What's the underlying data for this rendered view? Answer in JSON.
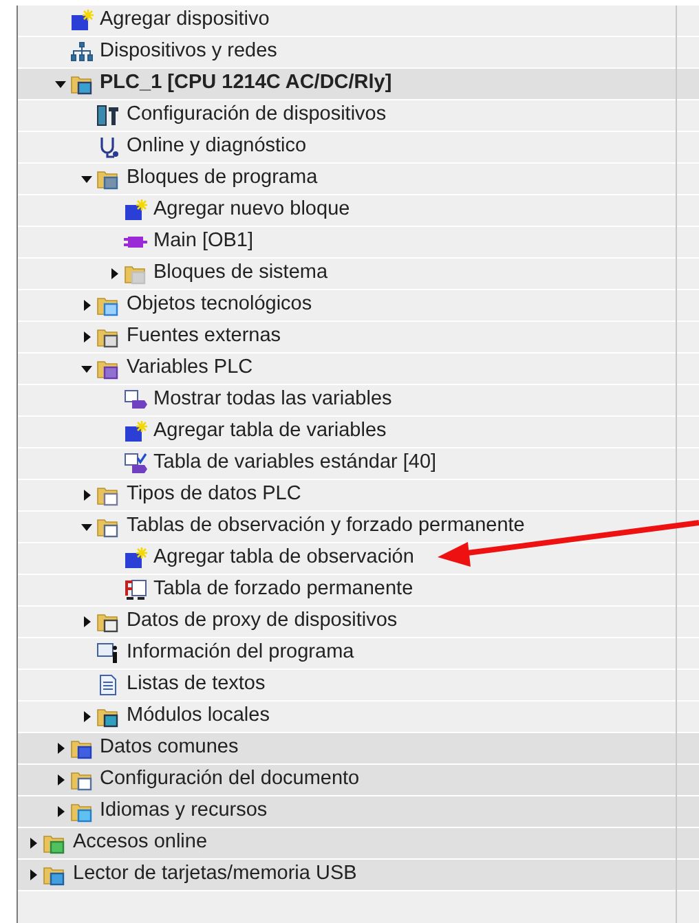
{
  "project_items": [
    {
      "label": "Agregar dispositivo",
      "kind": "add",
      "highlighted": false
    },
    {
      "label": "Dispositivos y redes",
      "kind": "network",
      "highlighted": false
    },
    {
      "label": "PLC_1 [CPU 1214C AC/DC/Rly]",
      "kind": "plc",
      "highlighted": true,
      "bold": true,
      "expanded": true,
      "children": [
        {
          "label": "Configuración de dispositivos",
          "kind": "config",
          "highlighted": false
        },
        {
          "label": "Online y diagnóstico",
          "kind": "diag",
          "highlighted": false
        },
        {
          "label": "Bloques de programa",
          "kind": "folder-blocks",
          "highlighted": false,
          "expanded": true,
          "children": [
            {
              "label": "Agregar nuevo bloque",
              "kind": "add",
              "highlighted": false
            },
            {
              "label": "Main [OB1]",
              "kind": "block",
              "highlighted": false
            },
            {
              "label": "Bloques de sistema",
              "kind": "folder-grey",
              "highlighted": false,
              "expanded": false
            }
          ]
        },
        {
          "label": "Objetos tecnológicos",
          "kind": "folder-tech",
          "highlighted": false,
          "expanded": false
        },
        {
          "label": "Fuentes externas",
          "kind": "folder-ext",
          "highlighted": false,
          "expanded": false
        },
        {
          "label": "Variables PLC",
          "kind": "folder-tags",
          "highlighted": false,
          "expanded": true,
          "children": [
            {
              "label": "Mostrar todas las variables",
              "kind": "tags",
              "highlighted": false
            },
            {
              "label": "Agregar tabla de variables",
              "kind": "add",
              "highlighted": false
            },
            {
              "label": "Tabla de variables estándar [40]",
              "kind": "tag-table",
              "highlighted": false
            }
          ]
        },
        {
          "label": "Tipos de datos PLC",
          "kind": "folder-types",
          "highlighted": false,
          "expanded": false
        },
        {
          "label": "Tablas de observación y forzado permanente",
          "kind": "folder-watch",
          "highlighted": false,
          "expanded": true,
          "children": [
            {
              "label": "Agregar tabla de observación",
              "kind": "add",
              "highlighted": false
            },
            {
              "label": "Tabla de forzado permanente",
              "kind": "force",
              "highlighted": false
            }
          ]
        },
        {
          "label": "Datos de proxy de dispositivos",
          "kind": "folder-proxy",
          "highlighted": false,
          "expanded": false
        },
        {
          "label": "Información del programa",
          "kind": "info",
          "highlighted": false
        },
        {
          "label": "Listas de textos",
          "kind": "textlist",
          "highlighted": false
        },
        {
          "label": "Módulos locales",
          "kind": "folder-modules",
          "highlighted": false,
          "expanded": false
        }
      ]
    },
    {
      "label": "Datos comunes",
      "kind": "folder-common",
      "highlighted": true,
      "expanded": false
    },
    {
      "label": "Configuración del documento",
      "kind": "folder-doc",
      "highlighted": true,
      "expanded": false
    },
    {
      "label": "Idiomas y recursos",
      "kind": "folder-lang",
      "highlighted": true,
      "expanded": false
    }
  ],
  "root_items": [
    {
      "label": "Accesos online",
      "kind": "folder-online",
      "highlighted": true,
      "expanded": false
    },
    {
      "label": "Lector de tarjetas/memoria USB",
      "kind": "folder-usb",
      "highlighted": true,
      "expanded": false
    }
  ]
}
